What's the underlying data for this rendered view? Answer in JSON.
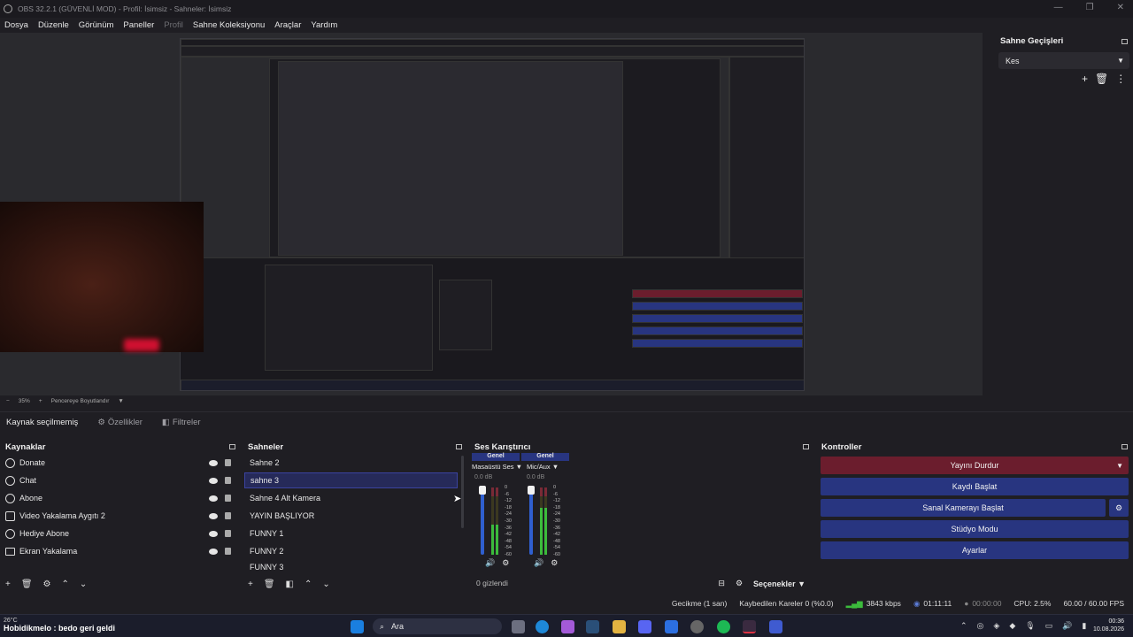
{
  "window": {
    "title": "OBS 32.2.1 (GÜVENLİ MOD) - Profil: İsimsiz - Sahneler: İsimsiz",
    "controls": [
      "minimize",
      "maximize",
      "close"
    ]
  },
  "menu": [
    "Dosya",
    "Düzenle",
    "Görünüm",
    "Paneller",
    "Profil",
    "Sahne Koleksiyonu",
    "Araçlar",
    "Yardım"
  ],
  "transitions": {
    "title": "Sahne Geçişleri",
    "selected": "Kes"
  },
  "zoom": {
    "value": "35%",
    "fit_label": "Pencereye Boyutlandır"
  },
  "context_bar": {
    "no_source": "Kaynak seçilmemiş",
    "properties": "Özellikler",
    "filters": "Filtreler"
  },
  "sources": {
    "title": "Kaynaklar",
    "items": [
      {
        "label": "Donate",
        "icon": "browser-icon"
      },
      {
        "label": "Chat",
        "icon": "browser-icon"
      },
      {
        "label": "Abone",
        "icon": "browser-icon"
      },
      {
        "label": "Video Yakalama Aygıtı 2",
        "icon": "camera-icon"
      },
      {
        "label": "Hediye Abone",
        "icon": "browser-icon"
      },
      {
        "label": "Ekran Yakalama",
        "icon": "monitor-icon"
      }
    ]
  },
  "scenes": {
    "title": "Sahneler",
    "items": [
      "Sahne 2",
      "sahne 3",
      "Sahne 4 Alt Kamera",
      "YAYIN BAŞLIYOR",
      "FUNNY 1",
      "FUNNY 2",
      "FUNNY 3"
    ],
    "selected_index": 1
  },
  "mixer": {
    "title": "Ses Karıştırıcı",
    "channels": [
      {
        "badge": "Genel",
        "name": "Masaüstü Ses",
        "db": "0.0 dB",
        "level": 0.45
      },
      {
        "badge": "Genel",
        "name": "Mic/Aux",
        "db": "0.0 dB",
        "level": 0.7
      }
    ],
    "ticks": [
      "0",
      "-6",
      "-12",
      "-18",
      "-24",
      "-30",
      "-36",
      "-42",
      "-48",
      "-54",
      "-60"
    ],
    "hidden": "0 gizlendi",
    "options": "Seçenekler"
  },
  "controls": {
    "title": "Kontroller",
    "stop_stream": "Yayını Durdur",
    "start_record": "Kaydı Başlat",
    "virtual_cam": "Sanal Kamerayı Başlat",
    "studio_mode": "Stüdyo Modu",
    "settings": "Ayarlar"
  },
  "status": {
    "delay": "Gecikme (1 san)",
    "dropped": "Kaybedilen Kareler 0 (%0.0)",
    "bitrate": "3843 kbps",
    "stream_time": "01:11:11",
    "rec_time": "00:00:00",
    "cpu": "CPU: 2.5%",
    "fps": "60.00 / 60.00 FPS"
  },
  "taskbar": {
    "weather": "26°C",
    "notification": "Hobidikmelo : bedo geri geldi",
    "search": "Ara",
    "time": "00:36",
    "date": "10.08.2026"
  },
  "colors": {
    "accent_blue": "#283580",
    "rec_red": "#6b1d2d",
    "selected_scene": "#262a59",
    "meter_green": "#3cbb3c"
  }
}
